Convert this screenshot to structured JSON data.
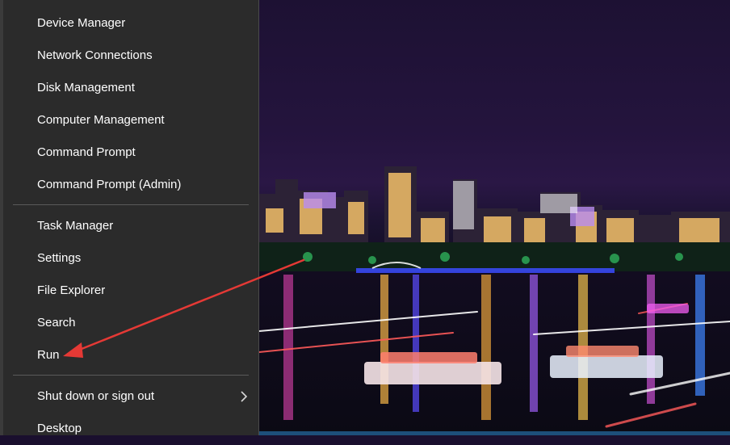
{
  "menu": {
    "group1": [
      {
        "label": "Device Manager"
      },
      {
        "label": "Network Connections"
      },
      {
        "label": "Disk Management"
      },
      {
        "label": "Computer Management"
      },
      {
        "label": "Command Prompt"
      },
      {
        "label": "Command Prompt (Admin)"
      }
    ],
    "group2": [
      {
        "label": "Task Manager"
      },
      {
        "label": "Settings"
      },
      {
        "label": "File Explorer"
      },
      {
        "label": "Search"
      },
      {
        "label": "Run"
      }
    ],
    "group3": [
      {
        "label": "Shut down or sign out",
        "icon": "chevron-right-icon"
      },
      {
        "label": "Desktop"
      }
    ]
  },
  "annotation": {
    "color": "#e53935",
    "target": "Run"
  },
  "colors": {
    "menu_bg": "#2b2b2b",
    "menu_text": "#ffffff",
    "separator": "#5a5a5a"
  }
}
